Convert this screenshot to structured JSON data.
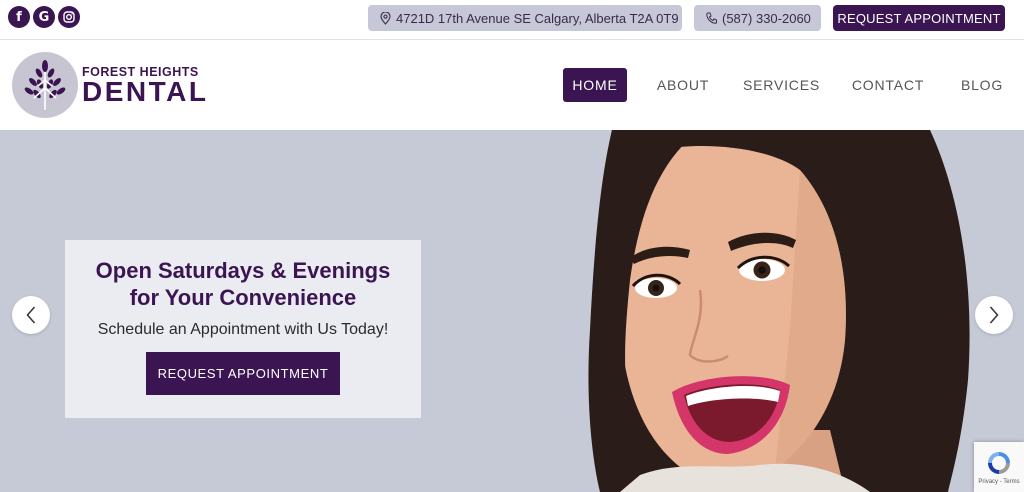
{
  "social": {
    "facebook_glyph": "f",
    "google_glyph": "G"
  },
  "topbar": {
    "address": "4721D 17th Avenue SE Calgary, Alberta T2A 0T9",
    "phone": "(587) 330-2060",
    "cta_label": "REQUEST APPOINTMENT"
  },
  "logo": {
    "line1": "FOREST HEIGHTS",
    "line2": "DENTAL"
  },
  "nav": {
    "items": [
      {
        "label": "HOME",
        "active": true
      },
      {
        "label": "ABOUT"
      },
      {
        "label": "SERVICES"
      },
      {
        "label": "CONTACT"
      },
      {
        "label": "BLOG"
      }
    ]
  },
  "hero": {
    "title_line1": "Open Saturdays & Evenings",
    "title_line2": "for Your Convenience",
    "subtitle": "Schedule an Appointment with Us Today!",
    "button_label": "REQUEST APPOINTMENT"
  },
  "recaptcha": {
    "links": "Privacy - Terms"
  },
  "colors": {
    "brand": "#3b1551",
    "pill_bg": "#c6c7d7",
    "hero_bg": "#c6c9d6",
    "promo_bg": "#ebecf2"
  },
  "icons": {
    "social": [
      "facebook-icon",
      "google-icon",
      "instagram-icon"
    ],
    "address": "map-pin-icon",
    "phone": "phone-icon",
    "slider": [
      "chevron-left-icon",
      "chevron-right-icon"
    ],
    "logo": "tree-leaves-icon",
    "captcha": "recaptcha-icon"
  }
}
